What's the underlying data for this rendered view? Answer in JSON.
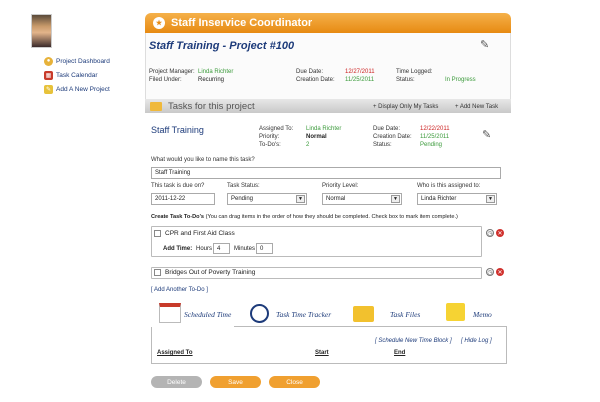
{
  "nav": {
    "items": [
      {
        "label": "Project Dashboard",
        "icon": "dashboard-icon"
      },
      {
        "label": "Task Calendar",
        "icon": "calendar-icon"
      },
      {
        "label": "Add A New Project",
        "icon": "add-project-icon"
      }
    ]
  },
  "header": {
    "title": "Staff Inservice Coordinator"
  },
  "project": {
    "title": "Staff Training - Project #100",
    "manager_label": "Project Manager:",
    "manager": "Linda Richter",
    "filed_label": "Filed Under:",
    "filed": "Recurring",
    "due_label": "Due Date:",
    "due": "12/27/2011",
    "created_label": "Creation Date:",
    "created": "11/25/2011",
    "time_label": "Time Logged:",
    "time": "",
    "status_label": "Status:",
    "status": "In Progress"
  },
  "tasks_section": {
    "title": "Tasks for this project",
    "display_mine": "+ Display Only My Tasks",
    "add_new": "+ Add New Task"
  },
  "task": {
    "title": "Staff Training",
    "assigned_label": "Assigned To:",
    "assigned": "Linda Richter",
    "priority_label": "Priority:",
    "priority": "Normal",
    "todos_label": "To-Do's:",
    "todos": "2",
    "due_label": "Due Date:",
    "due": "12/22/2011",
    "created_label": "Creation Date:",
    "created": "11/25/2011",
    "status_label": "Status:",
    "status": "Pending"
  },
  "form": {
    "name_question": "What would you like to name this task?",
    "name_value": "Staff Training",
    "due_question": "This task is due on?",
    "due_value": "2011-12-22",
    "status_label": "Task Status:",
    "status_value": "Pending",
    "priority_label": "Priority Level:",
    "priority_value": "Normal",
    "assign_label": "Who is this assigned to:",
    "assign_value": "Linda Richter",
    "todos_heading": "Create Task To-Do's",
    "todos_hint": "(You can drag items in the order of how they should be completed. Check box to mark item complete.)"
  },
  "todos": [
    {
      "label": "CPR and First Aid Class"
    },
    {
      "label": "Bridges Out of Poverty Training"
    }
  ],
  "add_time": {
    "label": "Add Time:",
    "hours_label": "Hours",
    "hours": "4",
    "minutes_label": "Minutes",
    "minutes": "0"
  },
  "add_todo_link": "[ Add Another To-Do ]",
  "tabs": [
    {
      "label": "Scheduled Time",
      "icon": "calendar-icon"
    },
    {
      "label": "Task Time Tracker",
      "icon": "clock-icon"
    },
    {
      "label": "Task Files",
      "icon": "folder-icon"
    },
    {
      "label": "Memo",
      "icon": "sticky-note-icon"
    }
  ],
  "schedule": {
    "schedule_link": "[ Schedule New Time Block ]",
    "hide_link": "[ Hide Log ]",
    "col_assigned": "Assigned To",
    "col_start": "Start",
    "col_end": "End"
  },
  "buttons": {
    "delete": "Delete",
    "save": "Save",
    "close": "Close"
  },
  "colors": {
    "accent": "#e78a12",
    "link": "#1d3b7a",
    "green": "#3a9a3a",
    "red": "#cc1f1f"
  }
}
